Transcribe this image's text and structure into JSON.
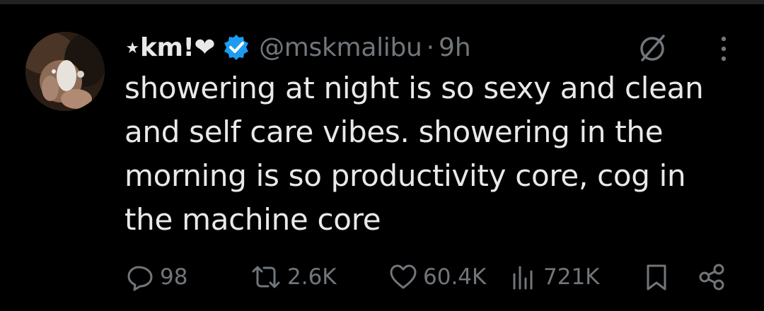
{
  "tweet": {
    "display_name": "⋆km!❤",
    "handle": "@mskmalibu",
    "separator": "·",
    "time": "9h",
    "body_lines": [
      "showering at night is so sexy and clean",
      "and self care vibes. showering in the",
      "morning is so productivity core, cog in",
      "the machine core"
    ],
    "actions": {
      "replies": "98",
      "reposts": "2.6K",
      "likes": "60.4K",
      "views": "721K"
    }
  },
  "icons": {
    "verified": "verified-badge-icon",
    "grok": "grok-icon",
    "more": "more-icon",
    "reply": "reply-icon",
    "repost": "repost-icon",
    "like": "heart-icon",
    "views": "views-icon",
    "bookmark": "bookmark-icon",
    "share": "share-icon"
  },
  "colors": {
    "background": "#000000",
    "text": "#e7e9ea",
    "muted": "#71767b",
    "verified_blue": "#1d9bf0"
  }
}
